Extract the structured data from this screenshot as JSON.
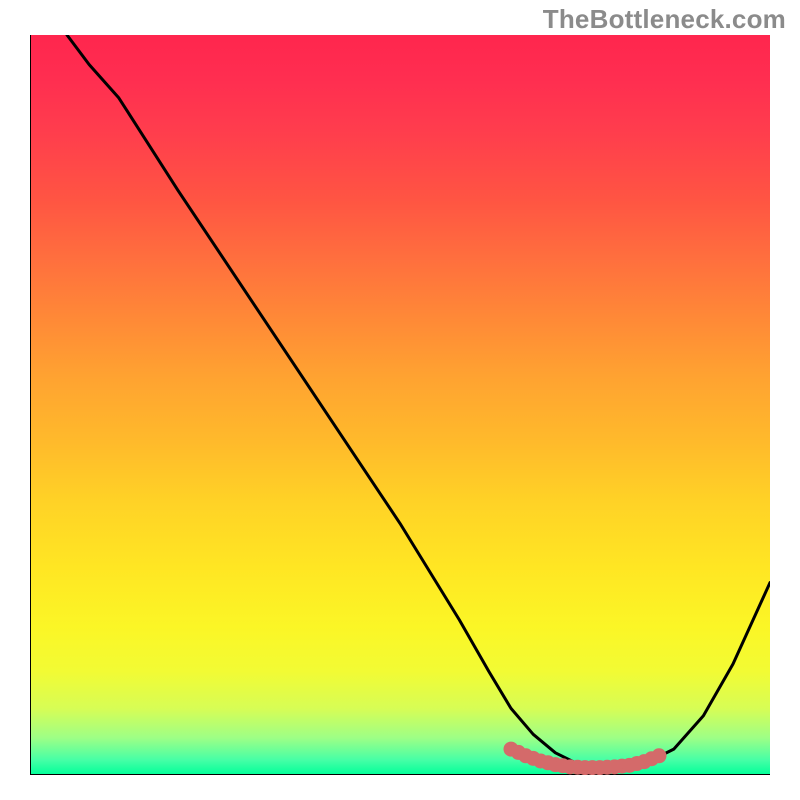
{
  "watermark": "TheBottleneck.com",
  "chart_data": {
    "type": "line",
    "title": "",
    "xlabel": "",
    "ylabel": "",
    "xlim": [
      0,
      100
    ],
    "ylim": [
      0,
      100
    ],
    "series": [
      {
        "name": "curve",
        "color": "#000000",
        "x": [
          5,
          8,
          12,
          20,
          30,
          40,
          50,
          58,
          62,
          65,
          68,
          71,
          74,
          77,
          80,
          83,
          87,
          91,
          95,
          100
        ],
        "y": [
          100,
          96,
          91.5,
          79,
          64,
          49,
          34,
          21,
          14,
          9,
          5.5,
          3,
          1.5,
          1,
          1,
          1.5,
          3.5,
          8,
          15,
          26
        ]
      },
      {
        "name": "highlight",
        "color": "#d46a6a",
        "style": "marker-dense",
        "x": [
          65,
          67,
          69,
          71,
          73,
          75,
          77,
          79,
          81,
          83,
          85
        ],
        "y": [
          3.5,
          2.6,
          1.9,
          1.4,
          1.1,
          1.0,
          1.0,
          1.1,
          1.3,
          1.8,
          2.6
        ]
      }
    ]
  }
}
